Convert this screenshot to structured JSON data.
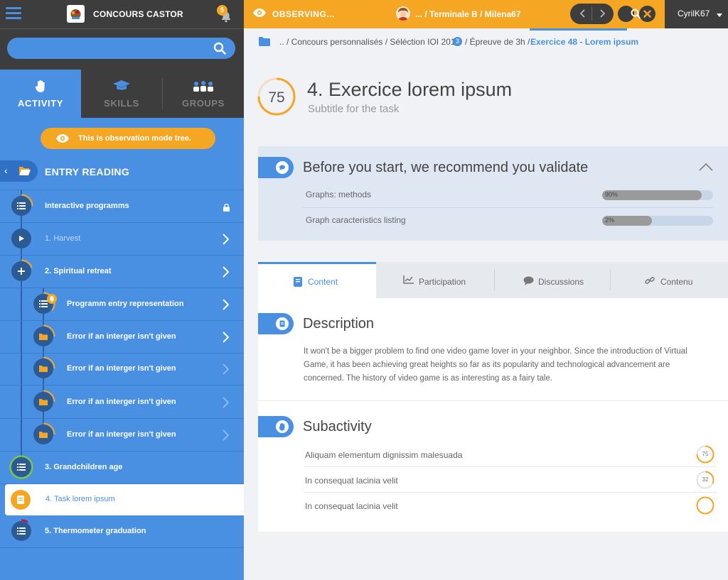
{
  "app": {
    "title": "CONCOURS CASTOR",
    "notifications": "5"
  },
  "search": {
    "placeholder": ""
  },
  "left_tabs": [
    {
      "label": "ACTIVITY",
      "icon": "hand-icon"
    },
    {
      "label": "SKILLS",
      "icon": "graduation-cap-icon"
    },
    {
      "label": "GROUPS",
      "icon": "group-icon"
    }
  ],
  "observation_banner": "This is observation mode tree.",
  "entry": {
    "title": "ENTRY READING"
  },
  "tree": [
    {
      "label": "Interactive programms",
      "icon": "list-icon",
      "locked": true,
      "progress": 0.25
    },
    {
      "label": "1. Harvest",
      "icon": "play-icon",
      "dim": true,
      "progress": 0
    },
    {
      "label": "2. Spiritual retreat",
      "icon": "plus-icon",
      "progress": 0.2
    },
    {
      "label": "Programm entry representation",
      "icon": "list-icon",
      "progress": 0.35,
      "notification": true
    },
    {
      "label": "Error if an interger isn't given",
      "icon": "folder-icon",
      "progress": 0.25
    },
    {
      "label": "Error if an interger isn't given",
      "icon": "folder-icon",
      "progress": 0.25
    },
    {
      "label": "Error if an interger isn't given",
      "icon": "folder-icon",
      "progress": 0.25
    },
    {
      "label": "Error if an interger isn't given",
      "icon": "folder-icon",
      "progress": 0.25
    },
    {
      "label": "3. Grandchildren age",
      "icon": "list-icon",
      "progress": 1.0
    },
    {
      "label": "4. Task lorem ipsum",
      "icon": "document-icon",
      "current": true
    },
    {
      "label": "5. Thermometer graduation",
      "icon": "list-icon",
      "progress": 0.1
    }
  ],
  "topbar": {
    "observing": "OBSERVING...",
    "user_path": "... / Terminale B /  Milena67",
    "username": "CyrilK67"
  },
  "breadcrumb": {
    "items": [
      ".. / Concours personnalisés / Séléction IOI 2012",
      "/ Épreuve de 3h /"
    ],
    "badge": "3",
    "current": "Exercice 48 - Lorem ipsum"
  },
  "task": {
    "score": "75",
    "score_fraction": 0.75,
    "title": "4. Exercice lorem ipsum",
    "subtitle": "Subtitle for the task"
  },
  "prerequisites": {
    "title": "Before you start, we recommend you validate",
    "items": [
      {
        "name": "Graphs: methods",
        "value": "90%",
        "fraction": 0.9
      },
      {
        "name": "Graph caracteristics listing",
        "value": "2%",
        "fraction": 0.02
      }
    ]
  },
  "content_tabs": [
    {
      "label": "Content",
      "icon": "book-icon"
    },
    {
      "label": "Participation",
      "icon": "chart-icon"
    },
    {
      "label": "Discussions",
      "icon": "chat-icon"
    },
    {
      "label": "Contenu",
      "icon": "link-icon"
    }
  ],
  "description": {
    "title": "Description",
    "body": "It won't be a bigger problem to find one video game lover in your neighbor. Since the introduction of Virtual Game, it has been achieving great heights so far as its popularity and technological advancement are concerned. The history of video game is as interesting as a fairy tale."
  },
  "subactivity": {
    "title": "Subactivity",
    "items": [
      {
        "name": "Aliquam elementum dignissim malesuada",
        "score": "75",
        "fraction": 0.75
      },
      {
        "name": "In consequat lacinia velit",
        "score": "32",
        "fraction": 0.32
      },
      {
        "name": "In consequat lacinia velit",
        "score": "",
        "fraction": 1.0
      }
    ]
  },
  "colors": {
    "accent": "#4a90e2",
    "warning": "#f5a623",
    "dark": "#3d3d3d"
  }
}
